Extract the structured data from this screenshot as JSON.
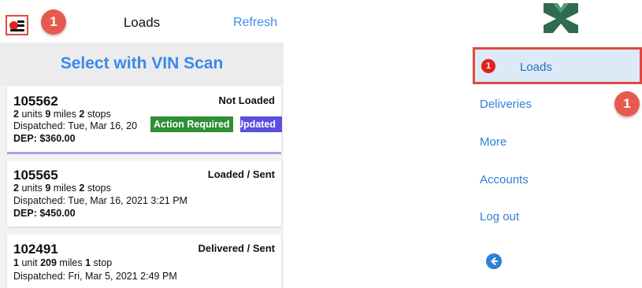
{
  "header": {
    "title": "Loads",
    "refresh_label": "Refresh",
    "callout_number": "1"
  },
  "scan_button": {
    "label": "Select with VIN Scan"
  },
  "loads": [
    {
      "id": "105562",
      "status": "Not Loaded",
      "units": "2",
      "units_word": "units",
      "miles": "9",
      "miles_word": "miles",
      "stops": "2",
      "stops_word": "stops",
      "dispatched": "Dispatched: Tue, Mar 16, 20",
      "dep": "DEP: $360.00",
      "tags": [
        "Action Required",
        "Updated"
      ],
      "tag_colors": [
        "#2f8f34",
        "#5a4ee0"
      ]
    },
    {
      "id": "105565",
      "status": "Loaded / Sent",
      "units": "2",
      "units_word": "units",
      "miles": "9",
      "miles_word": "miles",
      "stops": "2",
      "stops_word": "stops",
      "dispatched": "Dispatched: Tue, Mar 16, 2021 3:21 PM",
      "dep": "DEP: $450.00"
    },
    {
      "id": "102491",
      "status": "Delivered / Sent",
      "units": "1",
      "units_word": "unit",
      "miles": "209",
      "miles_word": "miles",
      "stops": "1",
      "stops_word": "stop",
      "dispatched": "Dispatched: Fri, Mar 5, 2021 2:49 PM"
    }
  ],
  "side_menu": {
    "logo_icon": "mm-logo-icon",
    "items": [
      {
        "label": "Loads",
        "badge": "1",
        "active": true
      },
      {
        "label": "Deliveries"
      },
      {
        "label": "More"
      },
      {
        "label": "Accounts"
      },
      {
        "label": "Log out"
      }
    ],
    "callout_number": "1",
    "back_icon": "back-arrow-icon"
  },
  "colors": {
    "accent_blue": "#3b8be6",
    "callout_red": "#e85a4f",
    "highlight_border": "#e0493d",
    "active_bg": "#dce9f7"
  }
}
